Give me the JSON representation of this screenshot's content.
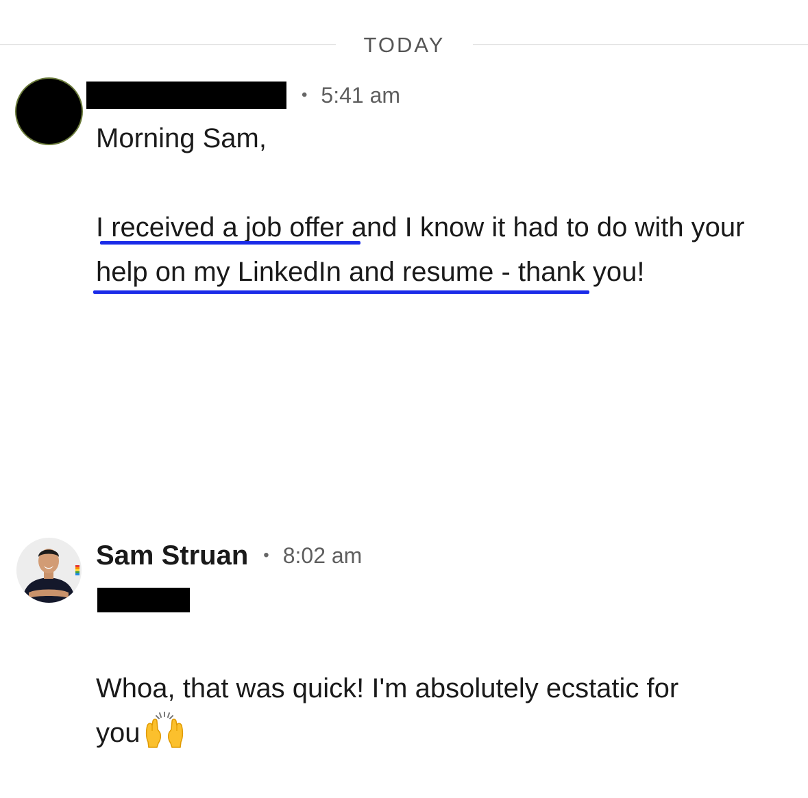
{
  "divider": {
    "label": "TODAY"
  },
  "messages": [
    {
      "sender": "",
      "sender_redacted": true,
      "time": "5:41 am",
      "lines": [
        "Morning Sam,",
        "I received a job offer and I know it had to do with your help on my LinkedIn and resume - thank you!"
      ],
      "highlight": "blue underline"
    },
    {
      "sender": "Sam Struan",
      "time": "8:02 am",
      "greeting_redacted": true,
      "lines": [
        "Whoa, that was quick! I'm absolutely ecstatic for",
        "you"
      ],
      "emoji": "raising-hands-emoji"
    }
  ],
  "colors": {
    "underline": "#1a2be8",
    "divider_line": "#e6e6e6",
    "text": "#1a1a1a",
    "muted": "#5e5e5e"
  }
}
